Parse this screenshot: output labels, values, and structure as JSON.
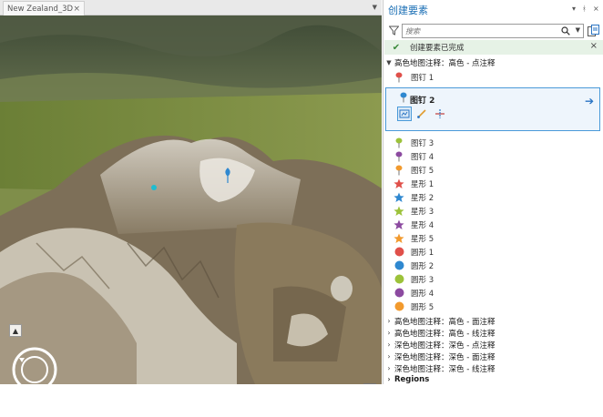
{
  "map": {
    "tab_label": "New Zealand_3D",
    "tab_close": "×",
    "tab_overflow": "▼"
  },
  "pane": {
    "title": "创建要素",
    "controls": [
      "▾",
      "ᚼ",
      "×"
    ],
    "search": {
      "placeholder": "搜索",
      "value": ""
    },
    "status": {
      "text": "创建要素已完成",
      "close": "×"
    },
    "groups": [
      {
        "label": "高色地图注释：高色 - 点注释",
        "expanded": true
      },
      {
        "label": "高色地图注释：高色 - 面注释",
        "expanded": false
      },
      {
        "label": "高色地图注释：高色 - 线注释",
        "expanded": false
      },
      {
        "label": "深色地图注释：深色 - 点注释",
        "expanded": false
      },
      {
        "label": "深色地图注释：深色 - 面注释",
        "expanded": false
      },
      {
        "label": "深色地图注释：深色 - 线注释",
        "expanded": false
      },
      {
        "label": "Regions",
        "expanded": false
      }
    ],
    "templates": [
      {
        "label": "图钉 1",
        "symbol": "pin",
        "color": "#e0504a"
      },
      {
        "label": "图钉 2",
        "symbol": "pin",
        "color": "#2f88d0",
        "selected": true
      },
      {
        "label": "图钉 3",
        "symbol": "pin",
        "color": "#9cc23a"
      },
      {
        "label": "图钉 4",
        "symbol": "pin",
        "color": "#8c4aa0"
      },
      {
        "label": "图钉 5",
        "symbol": "pin",
        "color": "#f29a2e"
      },
      {
        "label": "星形 1",
        "symbol": "star",
        "color": "#e0504a"
      },
      {
        "label": "星形 2",
        "symbol": "star",
        "color": "#2f88d0"
      },
      {
        "label": "星形 3",
        "symbol": "star",
        "color": "#9cc23a"
      },
      {
        "label": "星形 4",
        "symbol": "star",
        "color": "#8c4aa0"
      },
      {
        "label": "星形 5",
        "symbol": "star",
        "color": "#f29a2e"
      },
      {
        "label": "圆形 1",
        "symbol": "circle",
        "color": "#e0504a"
      },
      {
        "label": "圆形 2",
        "symbol": "circle",
        "color": "#2f88d0"
      },
      {
        "label": "圆形 3",
        "symbol": "circle",
        "color": "#9cc23a"
      },
      {
        "label": "圆形 4",
        "symbol": "circle",
        "color": "#8c4aa0"
      },
      {
        "label": "圆形 5",
        "symbol": "circle",
        "color": "#f29a2e"
      }
    ],
    "selected_tools": [
      "point-tool-icon",
      "line-tool-icon",
      "split-tool-icon"
    ],
    "selected_arrow": "➔",
    "colors": {
      "accent": "#1b6fb5",
      "selection": "#4a9ad9",
      "status_bg": "#e6f2e6"
    }
  }
}
